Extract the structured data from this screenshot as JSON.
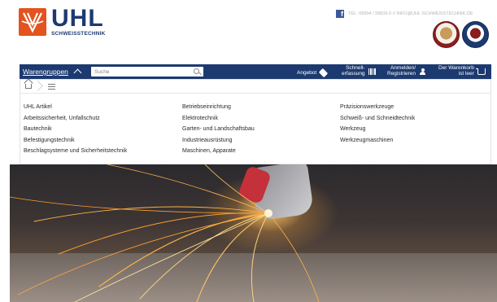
{
  "header": {
    "logo_text": "UHL",
    "logo_subtext": "SCHWEISSTECHNIK",
    "contact": "TEL: 06894 / 99833-0 // INFO@UHL-SCHWEISSTECHNIK.DE"
  },
  "nav": {
    "categories_label": "Warengruppen",
    "search_placeholder": "Suche",
    "offer_label": "Angebot",
    "quick_entry_line1": "Schnell-",
    "quick_entry_line2": "erfassung",
    "login_line1": "Anmelden/",
    "login_line2": "Registrieren",
    "cart_line1": "Der Warenkorb",
    "cart_line2": "ist leer"
  },
  "categories": {
    "col1": [
      "UHL Artikel",
      "Arbeitssicherheit, Unfallschutz",
      "Bautechnik",
      "Befestigungstechnik",
      "Beschlagsysteme und Sicherheitstechnik"
    ],
    "col2": [
      "Betriebseinrichtung",
      "Elektrotechnik",
      "Garten- und Landschaftsbau",
      "Industrieausrüstung",
      "Maschinen, Apparate"
    ],
    "col3": [
      "Präzisionswerkzeuge",
      "Schweiß- und Schneidtechnik",
      "Werkzeug",
      "Werkzeugmaschinen"
    ]
  },
  "colors": {
    "brand_blue": "#1d3a70",
    "brand_orange": "#e2531f"
  }
}
